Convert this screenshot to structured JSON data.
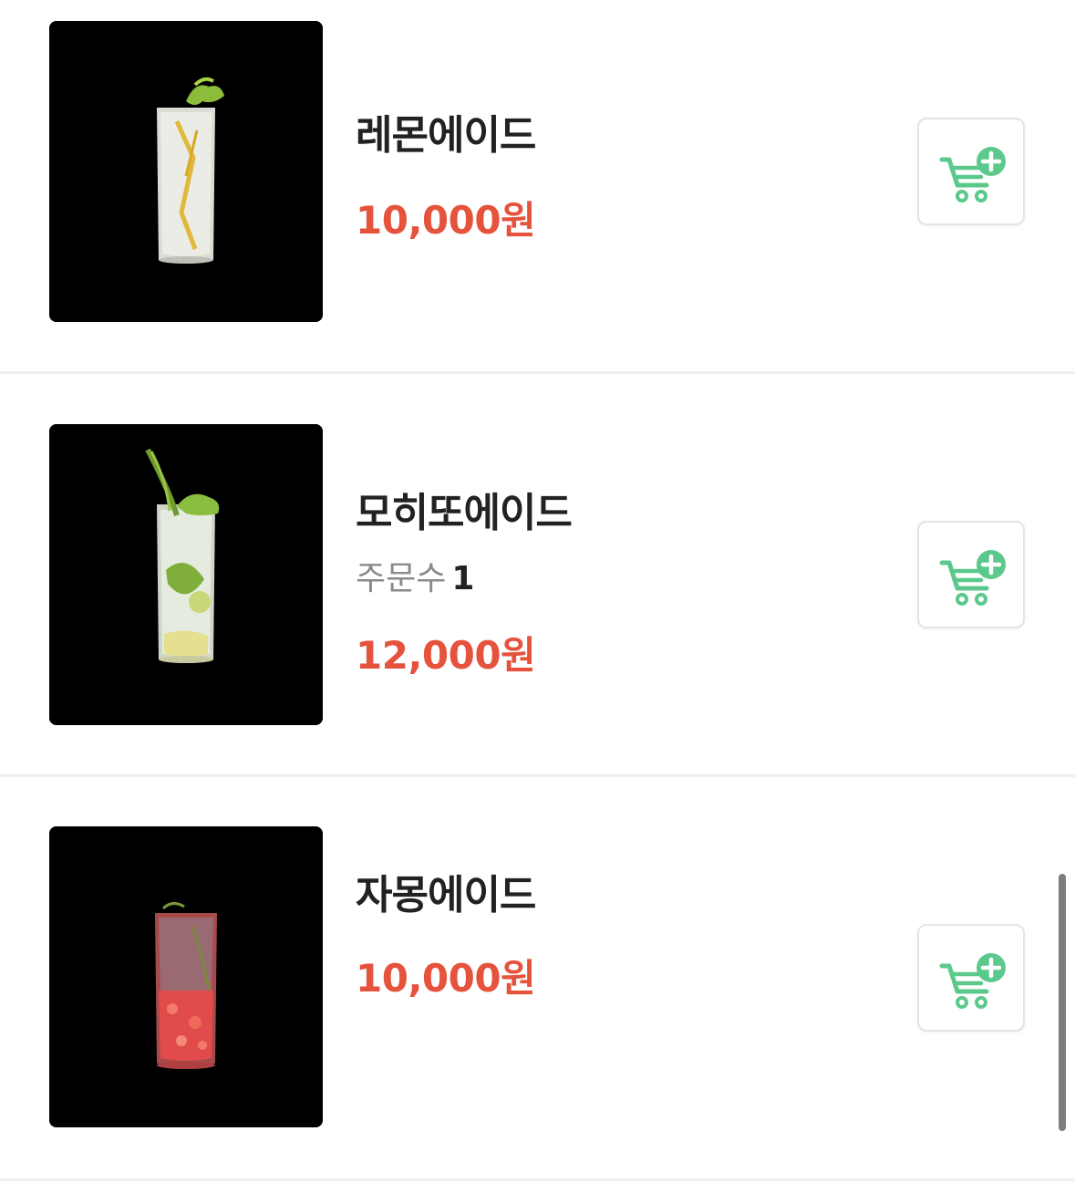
{
  "currency_suffix": "원",
  "accent_price_color": "#e5533d",
  "cart_icon_color": "#5cc98c",
  "items": [
    {
      "name": "레몬에이드",
      "price": "10,000원",
      "image_label": "lemonade-glass",
      "cart_icon": "cart-plus-icon"
    },
    {
      "name": "모히또에이드",
      "orders_label": "주문수",
      "orders_count": "1",
      "price": "12,000원",
      "image_label": "mojito-glass",
      "cart_icon": "cart-plus-icon"
    },
    {
      "name": "자몽에이드",
      "price": "10,000원",
      "image_label": "grapefruit-glass",
      "cart_icon": "cart-plus-icon"
    }
  ]
}
